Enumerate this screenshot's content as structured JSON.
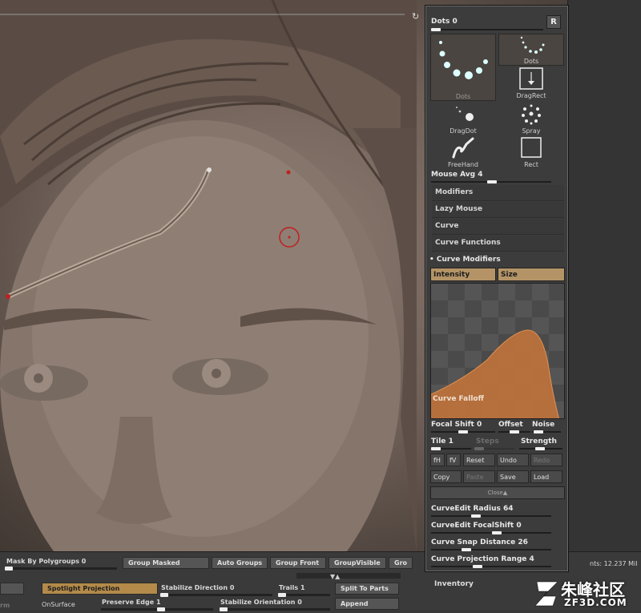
{
  "panel": {
    "dots_label": "Dots",
    "dots_value": "0",
    "r_button": "R",
    "strokes": [
      {
        "id": "dots-large",
        "caption": "Dots"
      },
      {
        "id": "dots-small",
        "caption": "Dots"
      },
      {
        "id": "dragrect",
        "caption": "DragRect"
      },
      {
        "id": "dragdot",
        "caption": "DragDot"
      },
      {
        "id": "spray",
        "caption": "Spray"
      },
      {
        "id": "freehand",
        "caption": "FreeHand"
      },
      {
        "id": "rect",
        "caption": "Rect"
      }
    ],
    "mouse_avg_label": "Mouse Avg",
    "mouse_avg_value": "4",
    "sections": [
      "Modifiers",
      "Lazy Mouse",
      "Curve",
      "Curve Functions"
    ],
    "curve_modifiers_label": "Curve Modifiers",
    "tabs": [
      "Intensity",
      "Size"
    ],
    "curve_falloff_label": "Curve Falloff",
    "focal_shift_label": "Focal Shift",
    "focal_shift_value": "0",
    "offset_label": "Offset",
    "noise_label": "Noise",
    "tile_label": "Tile",
    "tile_value": "1",
    "steps_label": "Steps",
    "strength_label": "Strength",
    "row1_buttons": [
      "fH",
      "fV",
      "Reset",
      "Undo",
      "Redo"
    ],
    "row2_buttons": [
      "Copy",
      "Paste",
      "Save",
      "Load"
    ],
    "close_label": "Close▲",
    "curve_edit_radius_label": "CurveEdit Radius",
    "curve_edit_radius_value": "64",
    "curve_edit_focalshift_label": "CurveEdit FocalShift",
    "curve_edit_focalshift_value": "0",
    "curve_snap_label": "Curve Snap Distance",
    "curve_snap_value": "26",
    "curve_proj_label": "Curve Projection Range",
    "curve_proj_value": "4",
    "inventory_label": "Inventory"
  },
  "bottom": {
    "mask_by_polygroups_label": "Mask By Polygroups",
    "mask_by_polygroups_value": "0",
    "group_masked": "Group Masked",
    "auto_groups": "Auto Groups",
    "group_front": "Group Front",
    "group_visible": "GroupVisible",
    "gro_truncated": "Gro",
    "spotlight_projection": "Spotlight Projection",
    "stabilize_direction_label": "Stabilize Direction",
    "stabilize_direction_value": "0",
    "trails_label": "Trails",
    "trails_value": "1",
    "split_to_parts": "Split To Parts",
    "onsurface": "OnSurface",
    "preserve_edge_label": "Preserve Edge",
    "preserve_edge_value": "1",
    "stabilize_orientation_label": "Stabilize Orientation",
    "stabilize_orientation_value": "0",
    "append": "Append",
    "points_text": "nts: 12.237 Mil",
    "rm_truncated": "rm"
  },
  "watermark": {
    "main": "朱峰社区",
    "sub": "ZF3D.COM"
  },
  "colors": {
    "accent": "#b49466",
    "curve_fill": "#c8763a",
    "panel_bg": "#3c3c3c"
  }
}
